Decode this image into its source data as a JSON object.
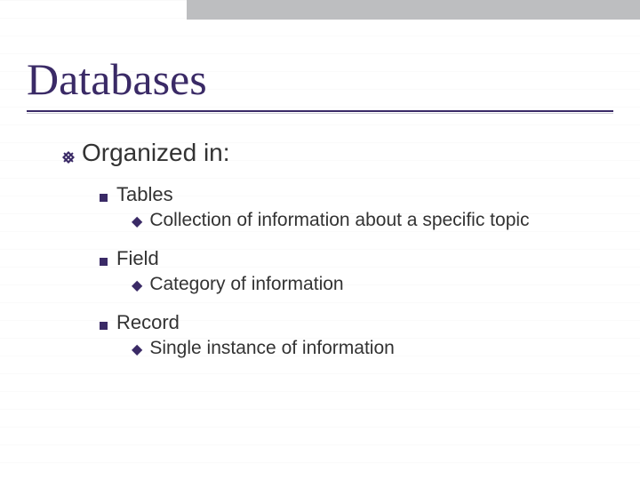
{
  "title": "Databases",
  "content": {
    "heading": "Organized in:",
    "items": [
      {
        "term": "Tables",
        "desc": "Collection of information about a specific topic"
      },
      {
        "term": "Field",
        "desc": "Category of information"
      },
      {
        "term": "Record",
        "desc": "Single instance of information"
      }
    ]
  }
}
